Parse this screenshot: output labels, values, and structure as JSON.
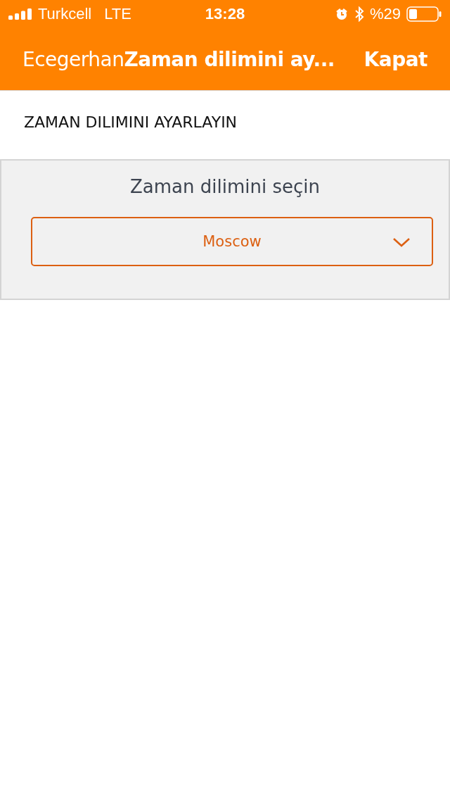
{
  "status_bar": {
    "carrier": "Turkcell",
    "network": "LTE",
    "time": "13:28",
    "battery": "%29"
  },
  "header": {
    "back_label": "Ecegerhan",
    "title": "Zaman dilimini ay...",
    "close": "Kapat"
  },
  "section_title": "ZAMAN DILIMINI AYARLAYIN",
  "panel": {
    "label": "Zaman dilimini seçin",
    "select": {
      "value": "Moscow"
    }
  }
}
